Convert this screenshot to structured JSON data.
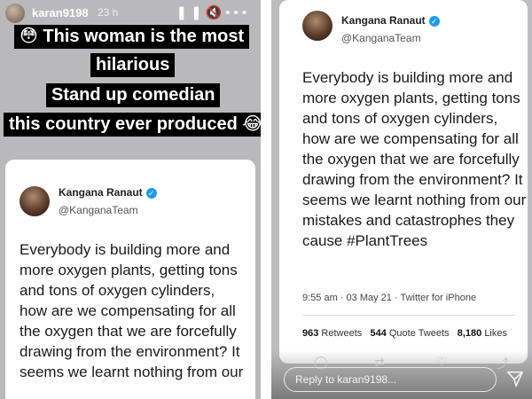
{
  "left_story": {
    "username": "karan9198",
    "time": "23 h",
    "caption_lines": [
      "😳 This woman is the most",
      "hilarious",
      "Stand up comedian",
      "this country ever produced 😂"
    ],
    "tweet": {
      "author_name": "Kangana Ranaut",
      "author_handle": "@KanganaTeam",
      "text_lines": [
        "Everybody is building more and",
        "more oxygen plants, getting tons",
        "and tons of oxygen cylinders,",
        "how are we compensating for all",
        "the oxygen that we are forcefully",
        "drawing from the environment? It",
        "seems we learnt nothing from our"
      ]
    }
  },
  "right_story": {
    "tweet": {
      "author_name": "Kangana Ranaut",
      "author_handle": "@KanganaTeam",
      "text_lines": [
        "Everybody is building more and",
        "more oxygen plants, getting tons",
        "and tons of oxygen cylinders,",
        "how are we compensating for all",
        "the oxygen that we are forcefully",
        "drawing from the environment? It",
        "seems we learnt nothing from our",
        "mistakes and catastrophes they",
        "cause #PlantTrees"
      ],
      "timestamp": "9:55 am · 03 May 21 · Twitter for iPhone",
      "retweets_count": "963",
      "retweets_label": "Retweets",
      "quotes_count": "544",
      "quotes_label": "Quote Tweets",
      "likes_count": "8,180",
      "likes_label": "Likes"
    },
    "reply_placeholder": "Reply to karan9198..."
  },
  "colors": {
    "story_bg": "#bbbbbd",
    "caption_bg": "#000000",
    "verified": "#1d9bf0"
  },
  "icons": [
    "pause-icon",
    "mute-icon",
    "more-icon",
    "verified-icon",
    "comment-icon",
    "retweet-icon",
    "like-icon",
    "share-icon",
    "send-icon"
  ]
}
